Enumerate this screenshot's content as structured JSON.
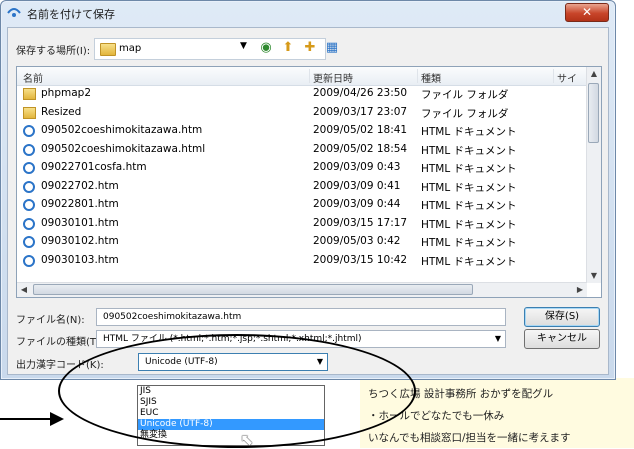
{
  "window": {
    "title": "名前を付けて保存",
    "close_label": "✕"
  },
  "location": {
    "label": "保存する場所(I):",
    "value": "map"
  },
  "columns": {
    "name": "名前",
    "date": "更新日時",
    "type": "種類",
    "size": "サイ"
  },
  "files": [
    {
      "icon": "folder",
      "name": "phpmap2",
      "date": "2009/04/26 23:50",
      "type": "ファイル フォルダ"
    },
    {
      "icon": "folder",
      "name": "Resized",
      "date": "2009/03/17 23:07",
      "type": "ファイル フォルダ"
    },
    {
      "icon": "html",
      "name": "090502coeshimokitazawa.htm",
      "date": "2009/05/02 18:41",
      "type": "HTML ドキュメント"
    },
    {
      "icon": "html",
      "name": "090502coeshimokitazawa.html",
      "date": "2009/05/02 18:54",
      "type": "HTML ドキュメント"
    },
    {
      "icon": "html",
      "name": "09022701cosfa.htm",
      "date": "2009/03/09 0:43",
      "type": "HTML ドキュメント"
    },
    {
      "icon": "html",
      "name": "09022702.htm",
      "date": "2009/03/09 0:41",
      "type": "HTML ドキュメント"
    },
    {
      "icon": "html",
      "name": "09022801.htm",
      "date": "2009/03/09 0:44",
      "type": "HTML ドキュメント"
    },
    {
      "icon": "html",
      "name": "09030101.htm",
      "date": "2009/03/15 17:17",
      "type": "HTML ドキュメント"
    },
    {
      "icon": "html",
      "name": "09030102.htm",
      "date": "2009/05/03 0:42",
      "type": "HTML ドキュメント"
    },
    {
      "icon": "html",
      "name": "09030103.htm",
      "date": "2009/03/15 10:42",
      "type": "HTML ドキュメント"
    }
  ],
  "filename": {
    "label": "ファイル名(N):",
    "value": "090502coeshimokitazawa.htm"
  },
  "filetype": {
    "label": "ファイルの種類(T):",
    "value": "HTML ファイル (*.html;*.htm;*.jsp;*.shtml;*.xhtml;*.jhtml)"
  },
  "encoding": {
    "label": "出力漢字コード(K):",
    "value": "Unicode (UTF-8)",
    "options": [
      "JIS",
      "SJIS",
      "EUC",
      "Unicode (UTF-8)",
      "無変換"
    ],
    "selected_index": 3
  },
  "buttons": {
    "save": "保存(S)",
    "cancel": "キャンセル"
  },
  "background_lines": [
    "ちつく広場 設計事務所 おかずを配グル",
    "・ホールでどなたでも一休み",
    "いなんでも相談窓口/担当を一緒に考えます"
  ],
  "colors": {
    "accent": "#3399ff",
    "window_border": "#6d88a8",
    "close_red": "#c8452a"
  }
}
